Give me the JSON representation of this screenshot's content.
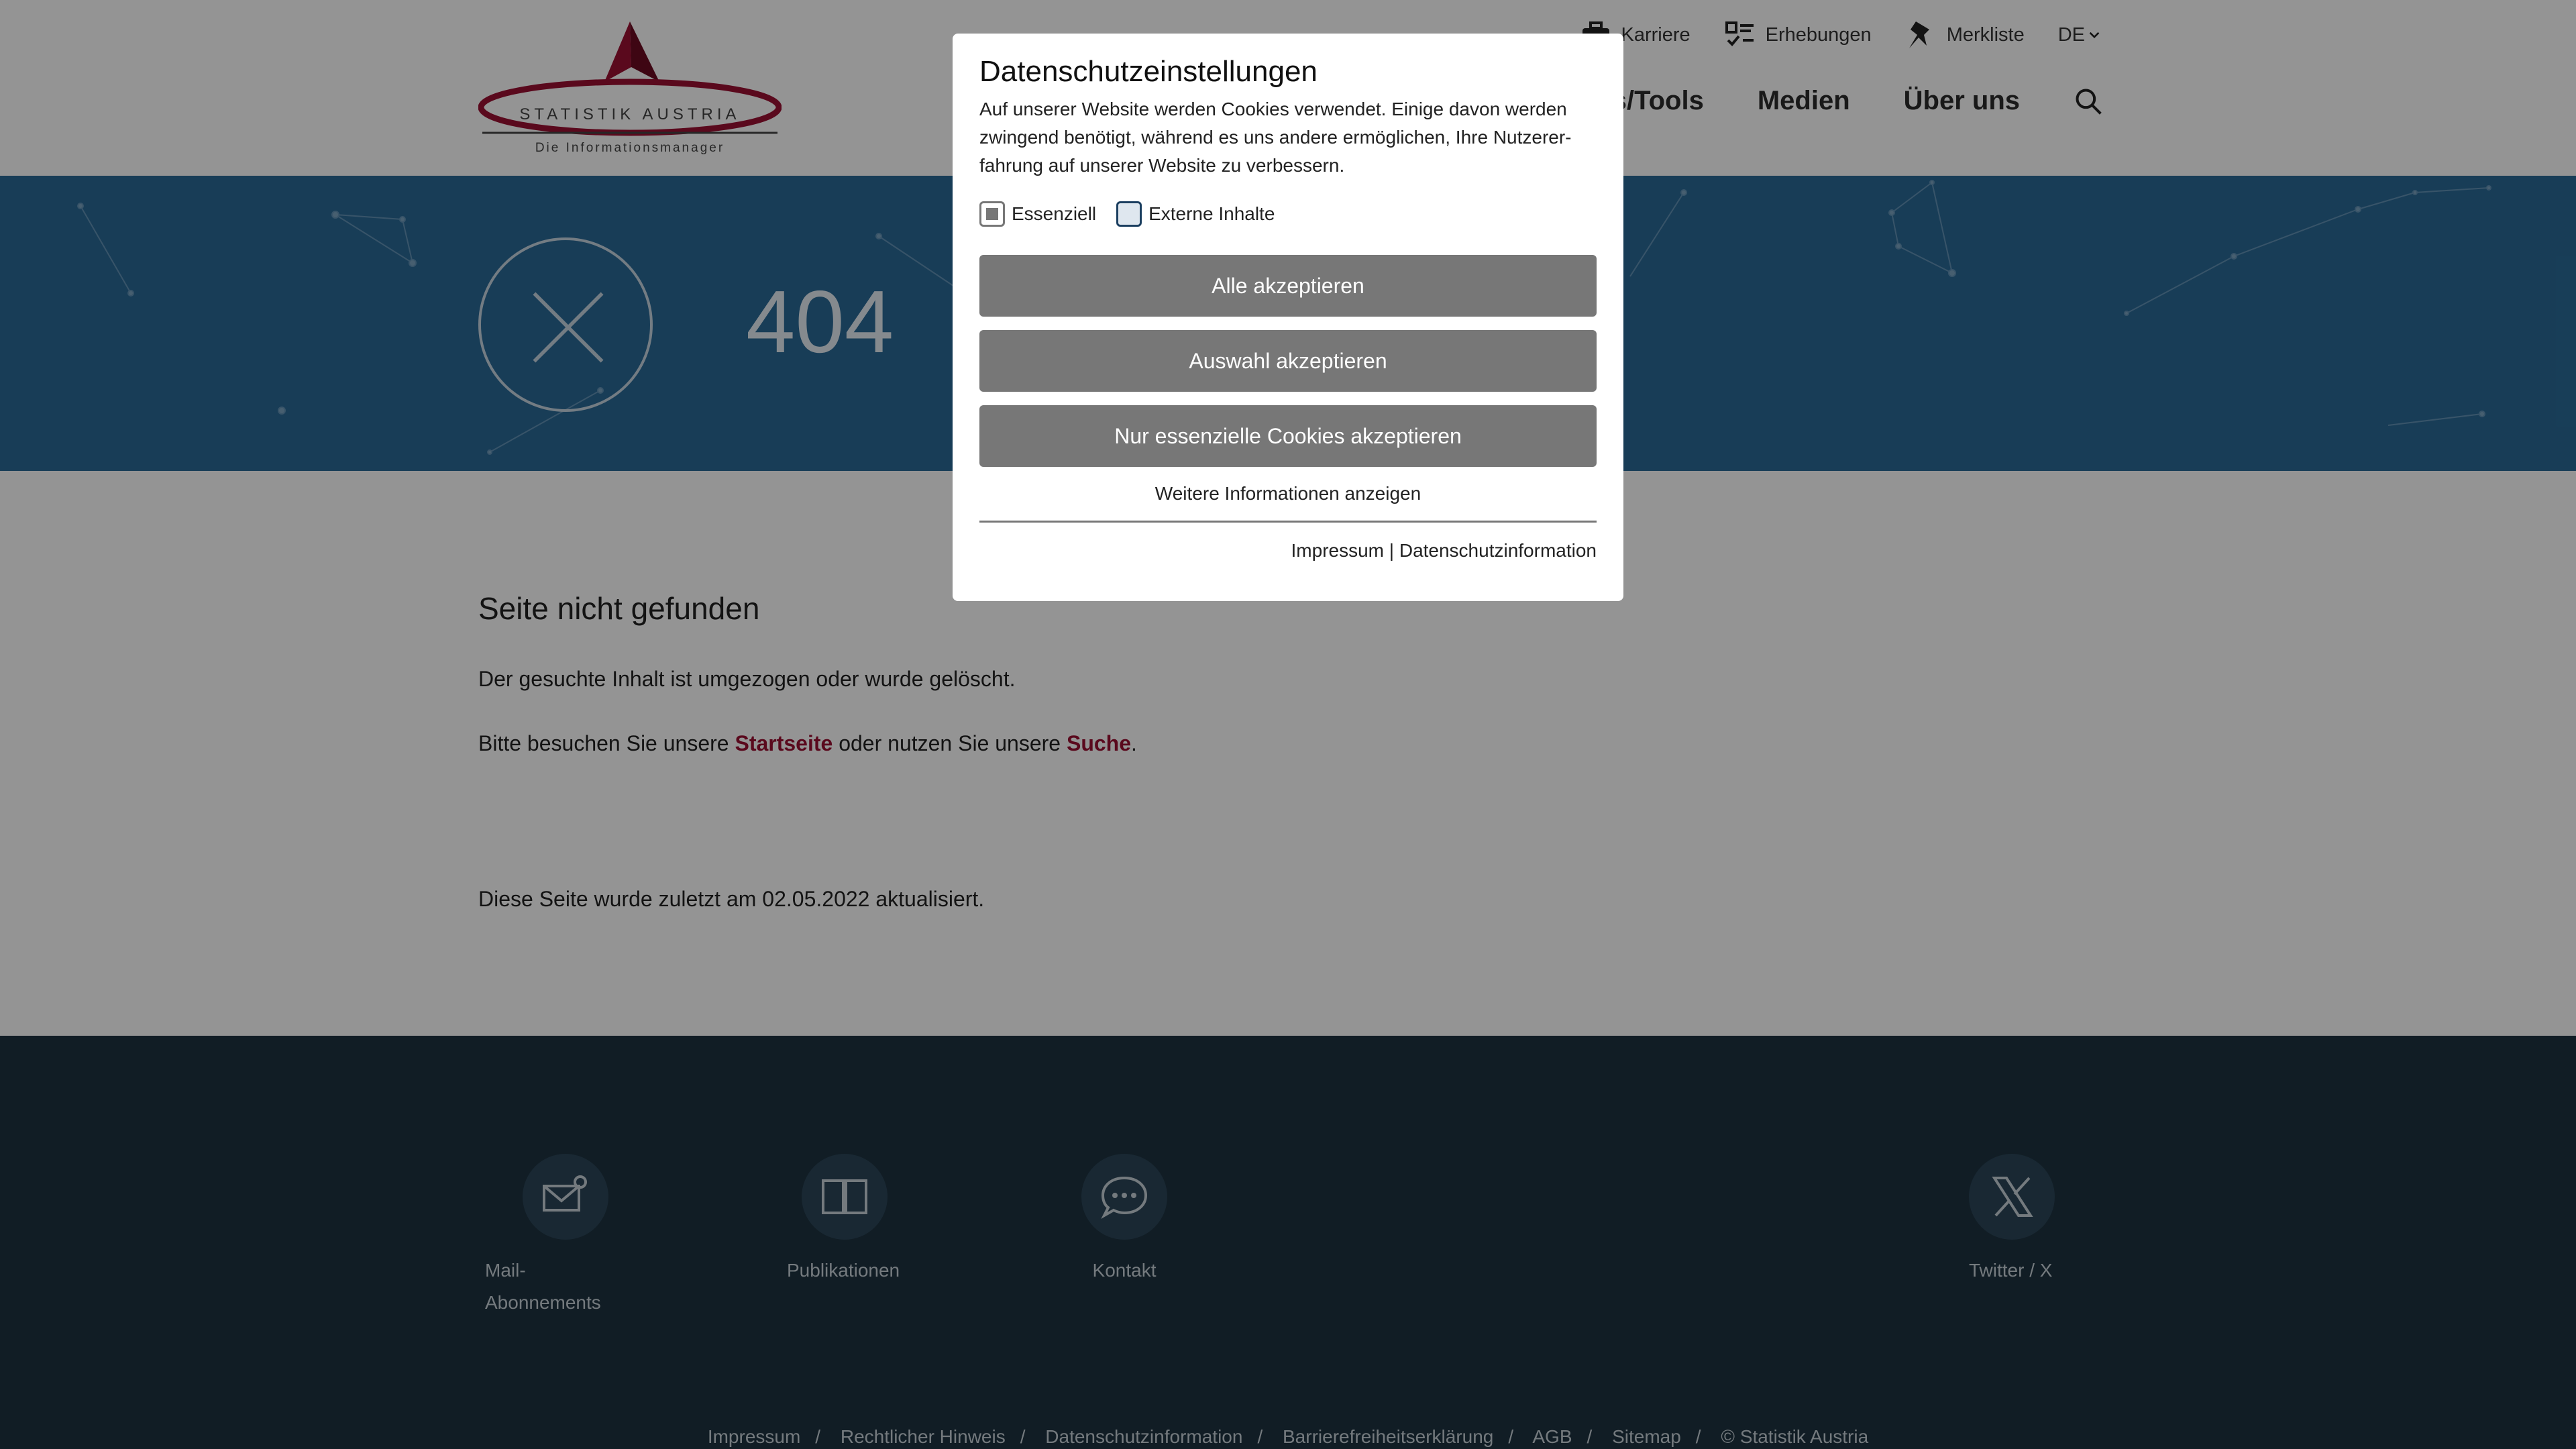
{
  "header": {
    "logo_text": "STATISTIK AUSTRIA",
    "logo_tagline": "Die Informationsmanager",
    "meta": [
      {
        "label": "Karriere",
        "icon": "briefcase-icon"
      },
      {
        "label": "Erhebungen",
        "icon": "survey-icon"
      },
      {
        "label": "Merkliste",
        "icon": "pin-icon"
      }
    ],
    "language": "DE",
    "nav": [
      "ces/Tools",
      "Medien",
      "Über uns"
    ]
  },
  "hero": {
    "code": "404"
  },
  "content": {
    "title": "Seite nicht gefunden",
    "p1": "Der gesuchte Inhalt ist umgezogen oder wurde gelöscht.",
    "p2_before": "Bitte besuchen Sie unsere ",
    "p2_link1": "Startseite",
    "p2_middle": " oder nutzen Sie unsere ",
    "p2_link2": "Suche",
    "p2_after": ".",
    "updated": "Diese Seite wurde zuletzt am 02.05.2022 aktualisiert."
  },
  "footer": {
    "items": [
      {
        "label": "Mail-Abonnements",
        "icon": "mail-icon"
      },
      {
        "label": "Publikationen",
        "icon": "book-icon"
      },
      {
        "label": "Kontakt",
        "icon": "chat-icon"
      },
      {
        "label": "Twitter / X",
        "icon": "x-icon"
      }
    ],
    "links": [
      "Impressum",
      "Rechtlicher Hinweis",
      "Datenschutzinformation",
      "Barrierefreiheitserklärung",
      "AGB",
      "Sitemap",
      "© Statistik Austria"
    ]
  },
  "modal": {
    "title": "Datenschutzeinstellungen",
    "intro": "Auf unserer Website werden Cookies verwendet. Einige davon werden zwingend benötigt, während es uns andere ermöglichen, Ihre Nutzerer-fahrung auf unserer Website zu verbessern.",
    "check_essential": "Essenziell",
    "check_external": "Externe Inhalte",
    "btn_all": "Alle akzeptieren",
    "btn_selection": "Auswahl akzeptieren",
    "btn_essential": "Nur essenzielle Cookies akzeptieren",
    "more": "Weitere Informationen anzeigen",
    "legal_impressum": "Impressum",
    "legal_sep": " | ",
    "legal_privacy": "Datenschutzinformation"
  },
  "colors": {
    "brand_red": "#9b1032",
    "hero_blue": "#2a6a97",
    "footer_dark": "#1e3240",
    "button_gray": "#777777"
  }
}
